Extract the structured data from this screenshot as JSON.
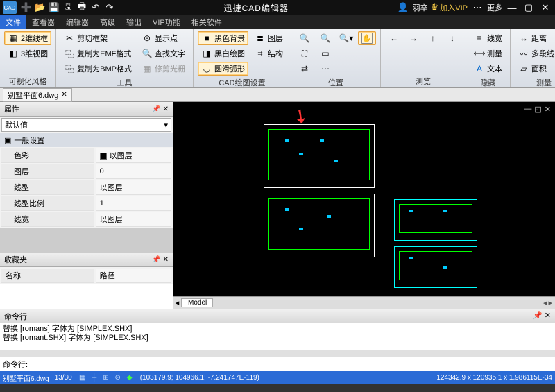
{
  "title": "迅捷CAD编辑器",
  "titlebar": {
    "user": "羽卒",
    "vip": "加入VIP",
    "more": "更多"
  },
  "menutabs": [
    "文件",
    "查看器",
    "编辑器",
    "高级",
    "输出",
    "VIP功能",
    "相关软件"
  ],
  "activeMenuTab": 0,
  "ribbon": {
    "visual": {
      "label": "可视化风格",
      "wire2d": "2维线框",
      "wire3d": "3维视图"
    },
    "tools": {
      "label": "工具",
      "cutframe": "剪切框架",
      "copyEMF": "复制为EMF格式",
      "copyBMP": "复制为BMP格式",
      "showpt": "显示点",
      "findtxt": "查找文字",
      "fixraster": "修剪光栅"
    },
    "cad": {
      "label": "CAD绘图设置",
      "blackbg": "黑色背景",
      "bwline": "黑白绘图",
      "smootharc": "圆滑弧形",
      "layer": "图层",
      "struct": "结构"
    },
    "pos": {
      "label": "位置"
    },
    "browse": {
      "label": "浏览"
    },
    "hide": {
      "label": "隐藏",
      "linewidth": "线宽",
      "measure": "测量",
      "text": "文本"
    },
    "meas": {
      "label": "测量",
      "dist": "距离",
      "polylen": "多段线长度",
      "area": "面积"
    }
  },
  "docTab": "别墅平面6.dwg",
  "propPanel": {
    "title": "属性",
    "dropdown": "默认值",
    "section": "一般设置",
    "rows": [
      {
        "k": "色彩",
        "v": "以图层",
        "swatch": true
      },
      {
        "k": "图层",
        "v": "0"
      },
      {
        "k": "线型",
        "v": "以图层"
      },
      {
        "k": "线型比例",
        "v": "1"
      },
      {
        "k": "线宽",
        "v": "以图层"
      }
    ]
  },
  "favPanel": {
    "title": "收藏夹",
    "col1": "名称",
    "col2": "路径"
  },
  "modelTab": "Model",
  "cmd": {
    "title": "命令行",
    "log1": "替换 [romans] 字体为 [SIMPLEX.SHX]",
    "log2": "替换 [romant.SHX] 字体为 [SIMPLEX.SHX]",
    "prompt": "命令行:"
  },
  "status": {
    "file": "别墅平面6.dwg",
    "page": "13/30",
    "coord": "(103179.9; 104966.1; -7.241747E-119)",
    "zoom": "124342.9 x 120935.1 x 1.986115E-34"
  }
}
